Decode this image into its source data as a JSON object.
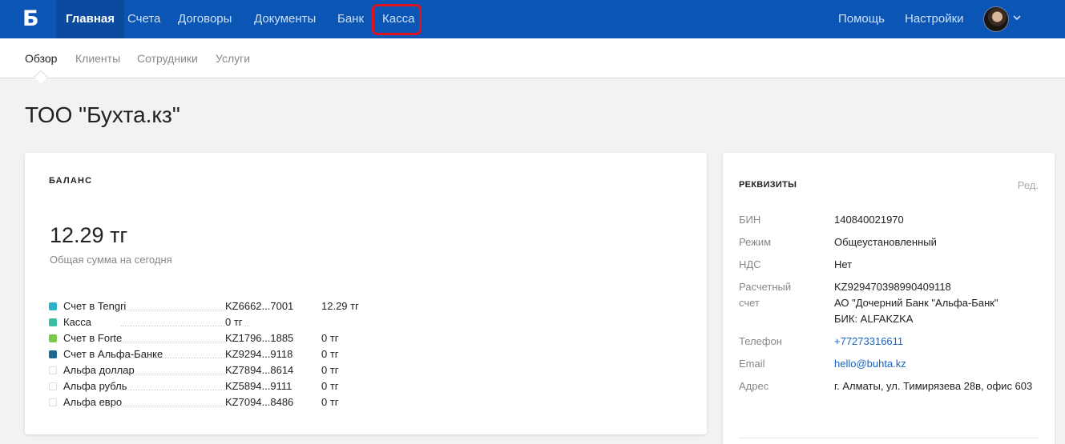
{
  "topnav": {
    "logo": "Б",
    "items": [
      {
        "label": "Главная",
        "active": true
      },
      {
        "label": "Счета"
      },
      {
        "label": "Договоры"
      },
      {
        "label": "Документы"
      },
      {
        "label": "Банк"
      },
      {
        "label": "Касса"
      }
    ],
    "right": [
      {
        "label": "Помощь"
      },
      {
        "label": "Настройки"
      }
    ],
    "avatar_icon": "user-avatar",
    "chevron_icon": "chevron-down-icon",
    "bg_color": "#0b55b5",
    "highlight_color": "#e0121b"
  },
  "subnav": {
    "items": [
      {
        "label": "Обзор",
        "active": true
      },
      {
        "label": "Клиенты"
      },
      {
        "label": "Сотрудники"
      },
      {
        "label": "Услуги"
      }
    ]
  },
  "page": {
    "title": "ТОО \"Бухта.кз\""
  },
  "balance": {
    "label": "БАЛАНС",
    "amount": "12.29 тг",
    "amount_caption": "Общая сумма на сегодня",
    "accounts": [
      {
        "name": "Счет в Tengri",
        "number": "KZ6662...7001",
        "value": "12.29 тг",
        "color": "#2bb3c9"
      },
      {
        "name": "Касса",
        "number": "0 тг",
        "value": "",
        "color": "#3bbfa3"
      },
      {
        "name": "Счет в Forte",
        "number": "KZ1796...1885",
        "value": "0 тг",
        "color": "#7cc84a"
      },
      {
        "name": "Счет в Альфа-Банке",
        "number": "KZ9294...9118",
        "value": "0 тг",
        "color": "#1d6a8f"
      },
      {
        "name": "Альфа доллар",
        "number": "KZ7894...8614",
        "value": "0 тг",
        "color": ""
      },
      {
        "name": "Альфа рубль",
        "number": "KZ5894...9111",
        "value": "0 тг",
        "color": ""
      },
      {
        "name": "Альфа евро",
        "number": "KZ7094...8486",
        "value": "0 тг",
        "color": ""
      }
    ]
  },
  "requisites": {
    "label": "РЕКВИЗИТЫ",
    "edit": "Ред.",
    "rows": [
      {
        "key": "БИН",
        "lines": [
          "140840021970"
        ]
      },
      {
        "key": "Режим",
        "lines": [
          "Общеустановленный"
        ]
      },
      {
        "key": "НДС",
        "lines": [
          "Нет"
        ]
      },
      {
        "key": "Расчетный счет",
        "lines": [
          "KZ929470398990409118",
          "АО \"Дочерний Банк \"Альфа-Банк\"",
          "БИК: ALFAKZKA"
        ]
      },
      {
        "key": "Телефон",
        "lines": [
          "+77273316611"
        ],
        "link": true
      },
      {
        "key": "Email",
        "lines": [
          "hello@buhta.kz"
        ],
        "link": true
      },
      {
        "key": "Адрес",
        "lines": [
          "г. Алматы, ул. Тимирязева 28в, офис 603"
        ]
      }
    ]
  }
}
